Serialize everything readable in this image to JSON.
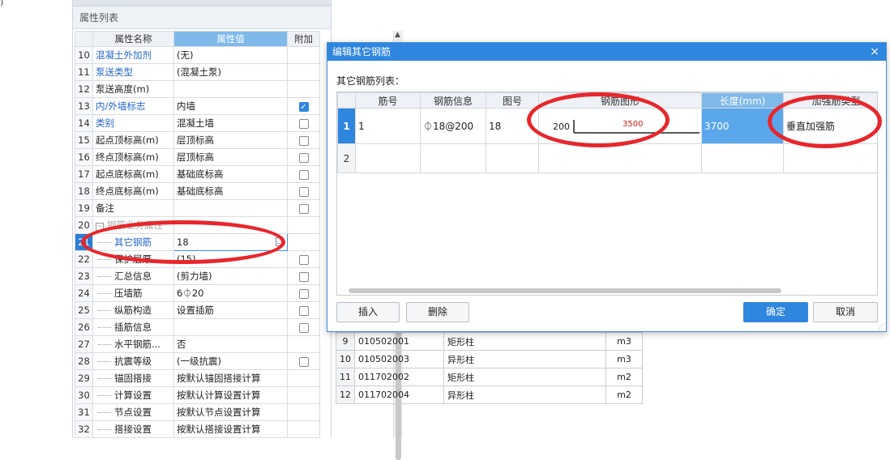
{
  "stray_text": ")",
  "property_panel": {
    "title": "属性列表",
    "headers": [
      "属性名称",
      "属性值",
      "附加"
    ],
    "rows": [
      {
        "num": "10",
        "name": "混凝土外加剂",
        "value": "(无)",
        "blue": true,
        "check": "none",
        "indent": false
      },
      {
        "num": "11",
        "name": "泵送类型",
        "value": "(混凝土泵)",
        "blue": true,
        "check": "none",
        "indent": false
      },
      {
        "num": "12",
        "name": "泵送高度(m)",
        "value": "",
        "blue": false,
        "check": "none",
        "indent": false
      },
      {
        "num": "13",
        "name": "内/外墙标志",
        "value": "内墙",
        "blue": true,
        "check": "on",
        "indent": false
      },
      {
        "num": "14",
        "name": "类别",
        "value": "混凝土墙",
        "blue": true,
        "check": "off",
        "indent": false
      },
      {
        "num": "15",
        "name": "起点顶标高(m)",
        "value": "层顶标高",
        "blue": false,
        "check": "off",
        "indent": false
      },
      {
        "num": "16",
        "name": "终点顶标高(m)",
        "value": "层顶标高",
        "blue": false,
        "check": "off",
        "indent": false
      },
      {
        "num": "17",
        "name": "起点底标高(m)",
        "value": "基础底标高",
        "blue": false,
        "check": "off",
        "indent": false
      },
      {
        "num": "18",
        "name": "终点底标高(m)",
        "value": "基础底标高",
        "blue": false,
        "check": "off",
        "indent": false
      },
      {
        "num": "19",
        "name": "备注",
        "value": "",
        "blue": false,
        "check": "off",
        "indent": false
      },
      {
        "num": "20",
        "name": "钢筋业务属性",
        "value": "",
        "blue": false,
        "check": "none",
        "indent": false,
        "group": true
      },
      {
        "num": "21",
        "name": "其它钢筋",
        "value": "18",
        "blue": true,
        "check": "none",
        "indent": true,
        "selected": true
      },
      {
        "num": "22",
        "name": "保护层厚",
        "value": "(15)",
        "blue": false,
        "check": "off",
        "indent": true
      },
      {
        "num": "23",
        "name": "汇总信息",
        "value": "(剪力墙)",
        "blue": false,
        "check": "off",
        "indent": true
      },
      {
        "num": "24",
        "name": "压墙筋",
        "value": "6⏀20",
        "blue": false,
        "check": "off",
        "indent": true
      },
      {
        "num": "25",
        "name": "纵筋构造",
        "value": "设置插筋",
        "blue": false,
        "check": "off",
        "indent": true
      },
      {
        "num": "26",
        "name": "插筋信息",
        "value": "",
        "blue": false,
        "check": "off",
        "indent": true
      },
      {
        "num": "27",
        "name": "水平钢筋...",
        "value": "否",
        "blue": false,
        "check": "none",
        "indent": true
      },
      {
        "num": "28",
        "name": "抗震等级",
        "value": "(一级抗震)",
        "blue": false,
        "check": "off",
        "indent": true
      },
      {
        "num": "29",
        "name": "锚固搭接",
        "value": "按默认锚固搭接计算",
        "blue": false,
        "check": "none",
        "indent": true
      },
      {
        "num": "30",
        "name": "计算设置",
        "value": "按默认计算设置计算",
        "blue": false,
        "check": "none",
        "indent": true
      },
      {
        "num": "31",
        "name": "节点设置",
        "value": "按默认节点设置计算",
        "blue": false,
        "check": "none",
        "indent": true
      },
      {
        "num": "32",
        "name": "搭接设置",
        "value": "按默认搭接设置计算",
        "blue": false,
        "check": "none",
        "indent": true
      }
    ]
  },
  "bg_list": [
    {
      "num": "9",
      "code": "010502001",
      "name": "矩形柱",
      "unit": "m3"
    },
    {
      "num": "10",
      "code": "010502003",
      "name": "异形柱",
      "unit": "m3"
    },
    {
      "num": "11",
      "code": "011702002",
      "name": "矩形柱",
      "unit": "m2"
    },
    {
      "num": "12",
      "code": "011702004",
      "name": "异形柱",
      "unit": "m2"
    }
  ],
  "dialog": {
    "title": "编辑其它钢筋",
    "close_icon": "×",
    "list_label": "其它钢筋列表：",
    "headers": [
      "",
      "筋号",
      "钢筋信息",
      "图号",
      "钢筋图形",
      "长度(mm)",
      "加强筋类型"
    ],
    "rows": [
      {
        "num": "1",
        "bar_no": "1",
        "info": "⏀18@200",
        "fig_no": "18",
        "shape_left": "200",
        "shape_mid": "3500",
        "length": "3700",
        "type": "垂直加强筋"
      },
      {
        "num": "2",
        "bar_no": "",
        "info": "",
        "fig_no": "",
        "shape_left": "",
        "shape_mid": "",
        "length": "",
        "type": ""
      }
    ],
    "buttons": {
      "insert": "插入",
      "delete": "删除",
      "ok": "确定",
      "cancel": "取消"
    }
  },
  "colors": {
    "accent": "#2f86de",
    "annotation": "#e8262b",
    "header_highlight": "#7fb9ea"
  }
}
